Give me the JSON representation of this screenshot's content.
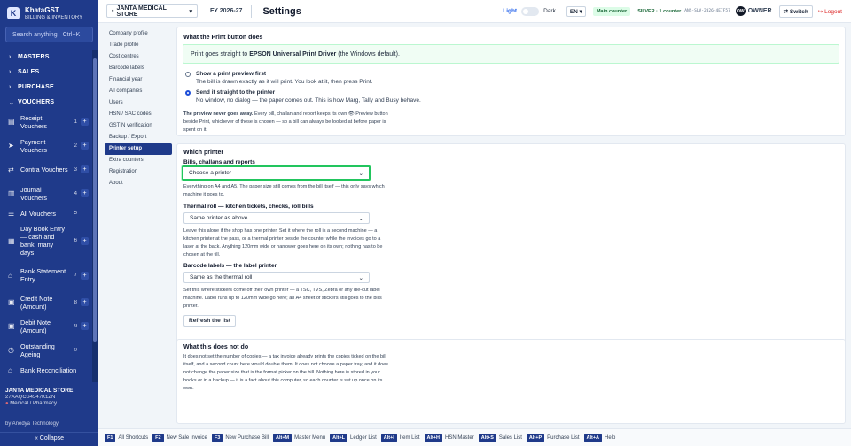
{
  "brand": {
    "name": "KhataGST",
    "subtitle": "BILLING & INVENTORY",
    "logo_letter": "K"
  },
  "search": {
    "placeholder": "Search anything",
    "shortcut": "Ctrl+K"
  },
  "sidebar": {
    "groups": [
      {
        "label": "MASTERS"
      },
      {
        "label": "SALES"
      },
      {
        "label": "PURCHASE"
      }
    ],
    "open_group": "VOUCHERS",
    "vouchers": [
      {
        "label": "Receipt Vouchers",
        "key": "1",
        "icon": "receipt-icon"
      },
      {
        "label": "Payment Vouchers",
        "key": "2",
        "icon": "payment-icon"
      },
      {
        "label": "Contra Vouchers",
        "key": "3",
        "icon": "contra-icon"
      },
      {
        "label": "Journal Vouchers",
        "key": "4",
        "icon": "journal-icon"
      },
      {
        "label": "All Vouchers",
        "key": "5",
        "icon": "list-icon"
      },
      {
        "label": "Day Book Entry — cash and bank, many days",
        "key": "6",
        "icon": "daybook-icon"
      },
      {
        "label": "Bank Statement Entry",
        "key": "7",
        "icon": "bank-icon"
      },
      {
        "label": "Credit Note (Amount)",
        "key": "8",
        "icon": "credit-note-icon"
      },
      {
        "label": "Debit Note (Amount)",
        "key": "9",
        "icon": "debit-note-icon"
      },
      {
        "label": "Outstanding Ageing",
        "key": "0",
        "icon": "ageing-icon"
      },
      {
        "label": "Bank Reconciliation",
        "key": "",
        "icon": "reconcile-icon"
      }
    ],
    "footer": {
      "firm": "JANTA MEDICAL STORE",
      "gstin": "27AAQCS4547K1ZN",
      "category": "Medical / Pharmacy",
      "by": "by Anedya Technology",
      "collapse": "« Collapse"
    }
  },
  "topbar": {
    "firm": "JANTA MEDICAL STORE",
    "fy": "FY 2026-27",
    "title": "Settings",
    "light": "Light",
    "dark": "Dark",
    "lang": "EN",
    "counter": "Main counter",
    "plan": "SILVER · 1 counter",
    "license": "ANS-SLV-2026-4E7F57",
    "avatar": "OW",
    "role": "OWNER",
    "switch": "Switch",
    "logout": "Logout"
  },
  "settings_nav": [
    "Company profile",
    "Trade profile",
    "Cost centres",
    "Barcode labels",
    "Financial year",
    "All companies",
    "Users",
    "HSN / SAC codes",
    "GSTIN verification",
    "Backup / Export",
    "Printer setup",
    "Extra counters",
    "Registration",
    "About"
  ],
  "settings_nav_active": "Printer setup",
  "print_button": {
    "heading": "What the Print button does",
    "note_pre": "Print goes straight to",
    "note_bold": "EPSON Universal Print Driver",
    "note_post": "(the Windows default).",
    "options": [
      {
        "title": "Show a print preview first",
        "desc": "The bill is drawn exactly as it will print. You look at it, then press Print.",
        "selected": false
      },
      {
        "title": "Send it straight to the printer",
        "desc": "No window, no dialog — the paper comes out. This is how Marg, Tally and Busy behave.",
        "selected": true
      }
    ],
    "preview_note_bold": "The preview never goes away.",
    "preview_note": "Every bill, challan and report keeps its own 👁 Preview button beside Print, whichever of these is chosen — so a bill can always be looked at before paper is spent on it."
  },
  "which_printer": {
    "heading": "Which printer",
    "bills_label": "Bills, challans and reports",
    "bills_value": "Choose a printer",
    "bills_help": "Everything on A4 and A5. The paper size still comes from the bill itself — this only says which machine it goes to.",
    "thermal_label": "Thermal roll — kitchen tickets, checks, roll bills",
    "thermal_value": "Same printer as above",
    "thermal_help": "Leave this alone if the shop has one printer. Set it where the roll is a second machine — a kitchen printer at the pass, or a thermal printer beside the counter while the invoices go to a laser at the back. Anything 120mm wide or narrower goes here on its own; nothing has to be chosen at the till.",
    "barcode_label": "Barcode labels — the label printer",
    "barcode_value": "Same as the thermal roll",
    "barcode_help": "Set this where stickers come off their own printer — a TSC, TVS, Zebra or any die-cut label machine. Label runs up to 120mm wide go here; an A4 sheet of stickers still goes to the bills printer.",
    "refresh": "Refresh the list"
  },
  "not_do": {
    "heading": "What this does not do",
    "text": "It does not set the number of copies — a tax invoice already prints the copies ticked on the bill itself, and a second count here would double them. It does not choose a paper tray, and it does not change the paper size that is the format picker on the bill. Nothing here is stored in your books or in a backup — it is a fact about this computer, so each counter is set up once on its own."
  },
  "shortcuts": [
    {
      "key": "F1",
      "label": "All Shortcuts"
    },
    {
      "key": "F2",
      "label": "New Sale Invoice"
    },
    {
      "key": "F3",
      "label": "New Purchase Bill"
    },
    {
      "key": "Alt+M",
      "label": "Master Menu"
    },
    {
      "key": "Alt+L",
      "label": "Ledger List"
    },
    {
      "key": "Alt+I",
      "label": "Item List"
    },
    {
      "key": "Alt+H",
      "label": "HSN Master"
    },
    {
      "key": "Alt+S",
      "label": "Sales List"
    },
    {
      "key": "Alt+P",
      "label": "Purchase List"
    },
    {
      "key": "Alt+A",
      "label": "Help"
    }
  ]
}
